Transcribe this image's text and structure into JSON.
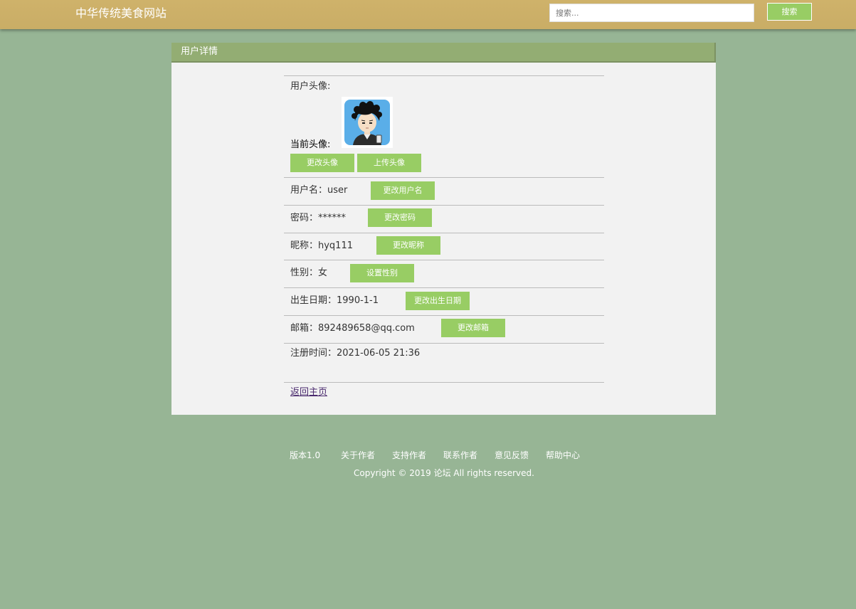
{
  "header": {
    "site_title": "中华传统美食网站",
    "search_placeholder": "搜索...",
    "search_button": "搜索"
  },
  "panel": {
    "title": "用户详情",
    "avatar_label": "用户头像:",
    "current_avatar_label": "当前头像:",
    "change_avatar_button": "更改头像",
    "upload_avatar_button": "上传头像",
    "username_label": "用户名：user",
    "change_username_button": "更改用户名",
    "password_label": "密码：******",
    "change_password_button": "更改密码",
    "nickname_label": "昵称：hyq111",
    "change_nickname_button": "更改昵称",
    "gender_label": "性别：女",
    "set_gender_button": "设置性别",
    "birthday_label": "出生日期：1990-1-1",
    "change_birthday_button": "更改出生日期",
    "email_label": "邮箱：892489658@qq.com",
    "change_email_button": "更改邮箱",
    "register_time_label": "注册时间：2021-06-05 21:36",
    "back_link": "返回主页"
  },
  "footer": {
    "links": [
      "版本1.0",
      "关于作者",
      "支持作者",
      "联系作者",
      "意见反馈",
      "帮助中心"
    ],
    "copyright": "Copyright © 2019 论坛 All rights reserved."
  },
  "colors": {
    "page_background": "#97b595",
    "header_background": "#cfb26a",
    "panel_header": "#93ad73",
    "button_green": "#98cd64"
  }
}
